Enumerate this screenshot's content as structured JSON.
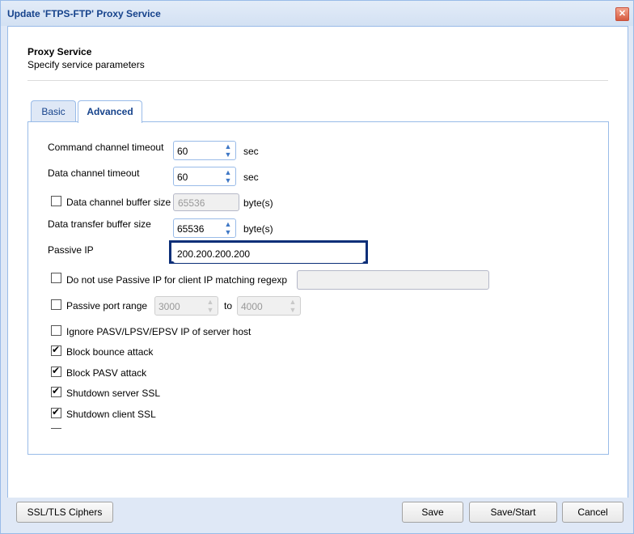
{
  "window": {
    "title": "Update 'FTPS-FTP' Proxy Service",
    "close_icon": "close-icon"
  },
  "header": {
    "title": "Proxy Service",
    "subtitle": "Specify service parameters"
  },
  "tabs": [
    {
      "label": "Basic",
      "active": false
    },
    {
      "label": "Advanced",
      "active": true
    }
  ],
  "form": {
    "command_timeout": {
      "label": "Command channel timeout",
      "value": "60",
      "unit": "sec"
    },
    "data_timeout": {
      "label": "Data channel timeout",
      "value": "60",
      "unit": "sec"
    },
    "data_buffer": {
      "label": "Data channel buffer size",
      "value": "65536",
      "unit": "byte(s)",
      "checked": false,
      "disabled": true
    },
    "transfer_buffer": {
      "label": "Data transfer buffer size",
      "value": "65536",
      "unit": "byte(s)"
    },
    "passive_ip": {
      "label": "Passive IP",
      "value": "200.200.200.200"
    },
    "no_passive_regexp": {
      "label": "Do not use Passive IP for client IP matching regexp",
      "checked": false,
      "value": ""
    },
    "passive_port_range": {
      "label": "Passive port range",
      "checked": false,
      "from": "3000",
      "to_label": "to",
      "to": "4000"
    },
    "ignore_pasv": {
      "label": "Ignore PASV/LPSV/EPSV IP of server host",
      "checked": false
    },
    "block_bounce": {
      "label": "Block bounce attack",
      "checked": true
    },
    "block_pasv": {
      "label": "Block PASV attack",
      "checked": true
    },
    "shutdown_server_ssl": {
      "label": "Shutdown server SSL",
      "checked": true
    },
    "shutdown_client_ssl": {
      "label": "Shutdown client SSL",
      "checked": true
    }
  },
  "footer": {
    "ciphers_label": "SSL/TLS Ciphers",
    "save_label": "Save",
    "save_start_label": "Save/Start",
    "cancel_label": "Cancel"
  }
}
